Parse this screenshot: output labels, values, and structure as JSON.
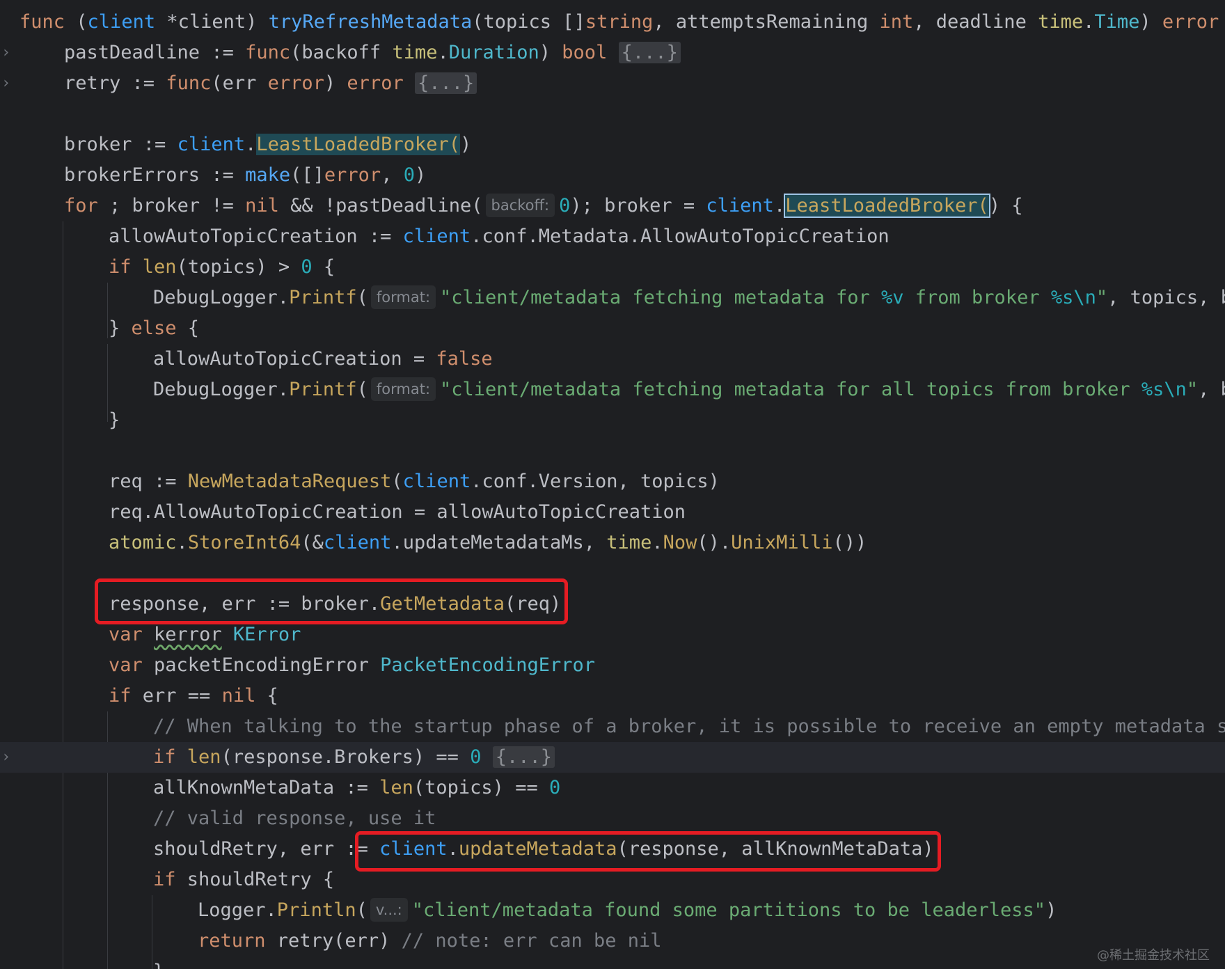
{
  "editor": {
    "watermark": "@稀土掘金技术社区",
    "fold_marker": "›",
    "fold_placeholder": "{...}",
    "hints": {
      "backoff": "backoff:",
      "format": "format:",
      "v": "v...:"
    },
    "colors": {
      "background": "#1e1f22",
      "keyword": "#cf8e6d",
      "string": "#6aab73",
      "number": "#2aacb8",
      "comment": "#7a7e85",
      "annotation_box": "#e51c23"
    },
    "lines": [
      {
        "text": "func (client *client) tryRefreshMetadata(topics []string, attemptsRemaining int, deadline time.Time) error {"
      },
      {
        "text": "pastDeadline := func(backoff time.Duration) bool {...}"
      },
      {
        "text": "retry := func(err error) error {...}"
      },
      {
        "text": ""
      },
      {
        "text": "broker := client.LeastLoadedBroker()"
      },
      {
        "text": "brokerErrors := make([]error, 0)"
      },
      {
        "text": "for ; broker != nil && !pastDeadline(backoff: 0); broker = client.LeastLoadedBroker() {"
      },
      {
        "text": "allowAutoTopicCreation := client.conf.Metadata.AllowAutoTopicCreation"
      },
      {
        "text": "if len(topics) > 0 {"
      },
      {
        "text": "DebugLogger.Printf(format: \"client/metadata fetching metadata for %v from broker %s\\n\", topics, br"
      },
      {
        "text": "} else {"
      },
      {
        "text": "allowAutoTopicCreation = false"
      },
      {
        "text": "DebugLogger.Printf(format: \"client/metadata fetching metadata for all topics from broker %s\\n\", br"
      },
      {
        "text": "}"
      },
      {
        "text": ""
      },
      {
        "text": "req := NewMetadataRequest(client.conf.Version, topics)"
      },
      {
        "text": "req.AllowAutoTopicCreation = allowAutoTopicCreation"
      },
      {
        "text": "atomic.StoreInt64(&client.updateMetadataMs, time.Now().UnixMilli())"
      },
      {
        "text": ""
      },
      {
        "text": "response, err := broker.GetMetadata(req)"
      },
      {
        "text": "var kerror KError"
      },
      {
        "text": "var packetEncodingError PacketEncodingError"
      },
      {
        "text": "if err == nil {"
      },
      {
        "text": "// When talking to the startup phase of a broker, it is possible to receive an empty metadata se"
      },
      {
        "text": "if len(response.Brokers) == 0 {...}"
      },
      {
        "text": "allKnownMetaData := len(topics) == 0"
      },
      {
        "text": "// valid response, use it"
      },
      {
        "text": "shouldRetry, err := client.updateMetadata(response, allKnownMetaData)"
      },
      {
        "text": "if shouldRetry {"
      },
      {
        "text": "Logger.Println(v...: \"client/metadata found some partitions to be leaderless\")"
      },
      {
        "text": "return retry(err) // note: err can be nil"
      },
      {
        "text": "}"
      }
    ]
  }
}
